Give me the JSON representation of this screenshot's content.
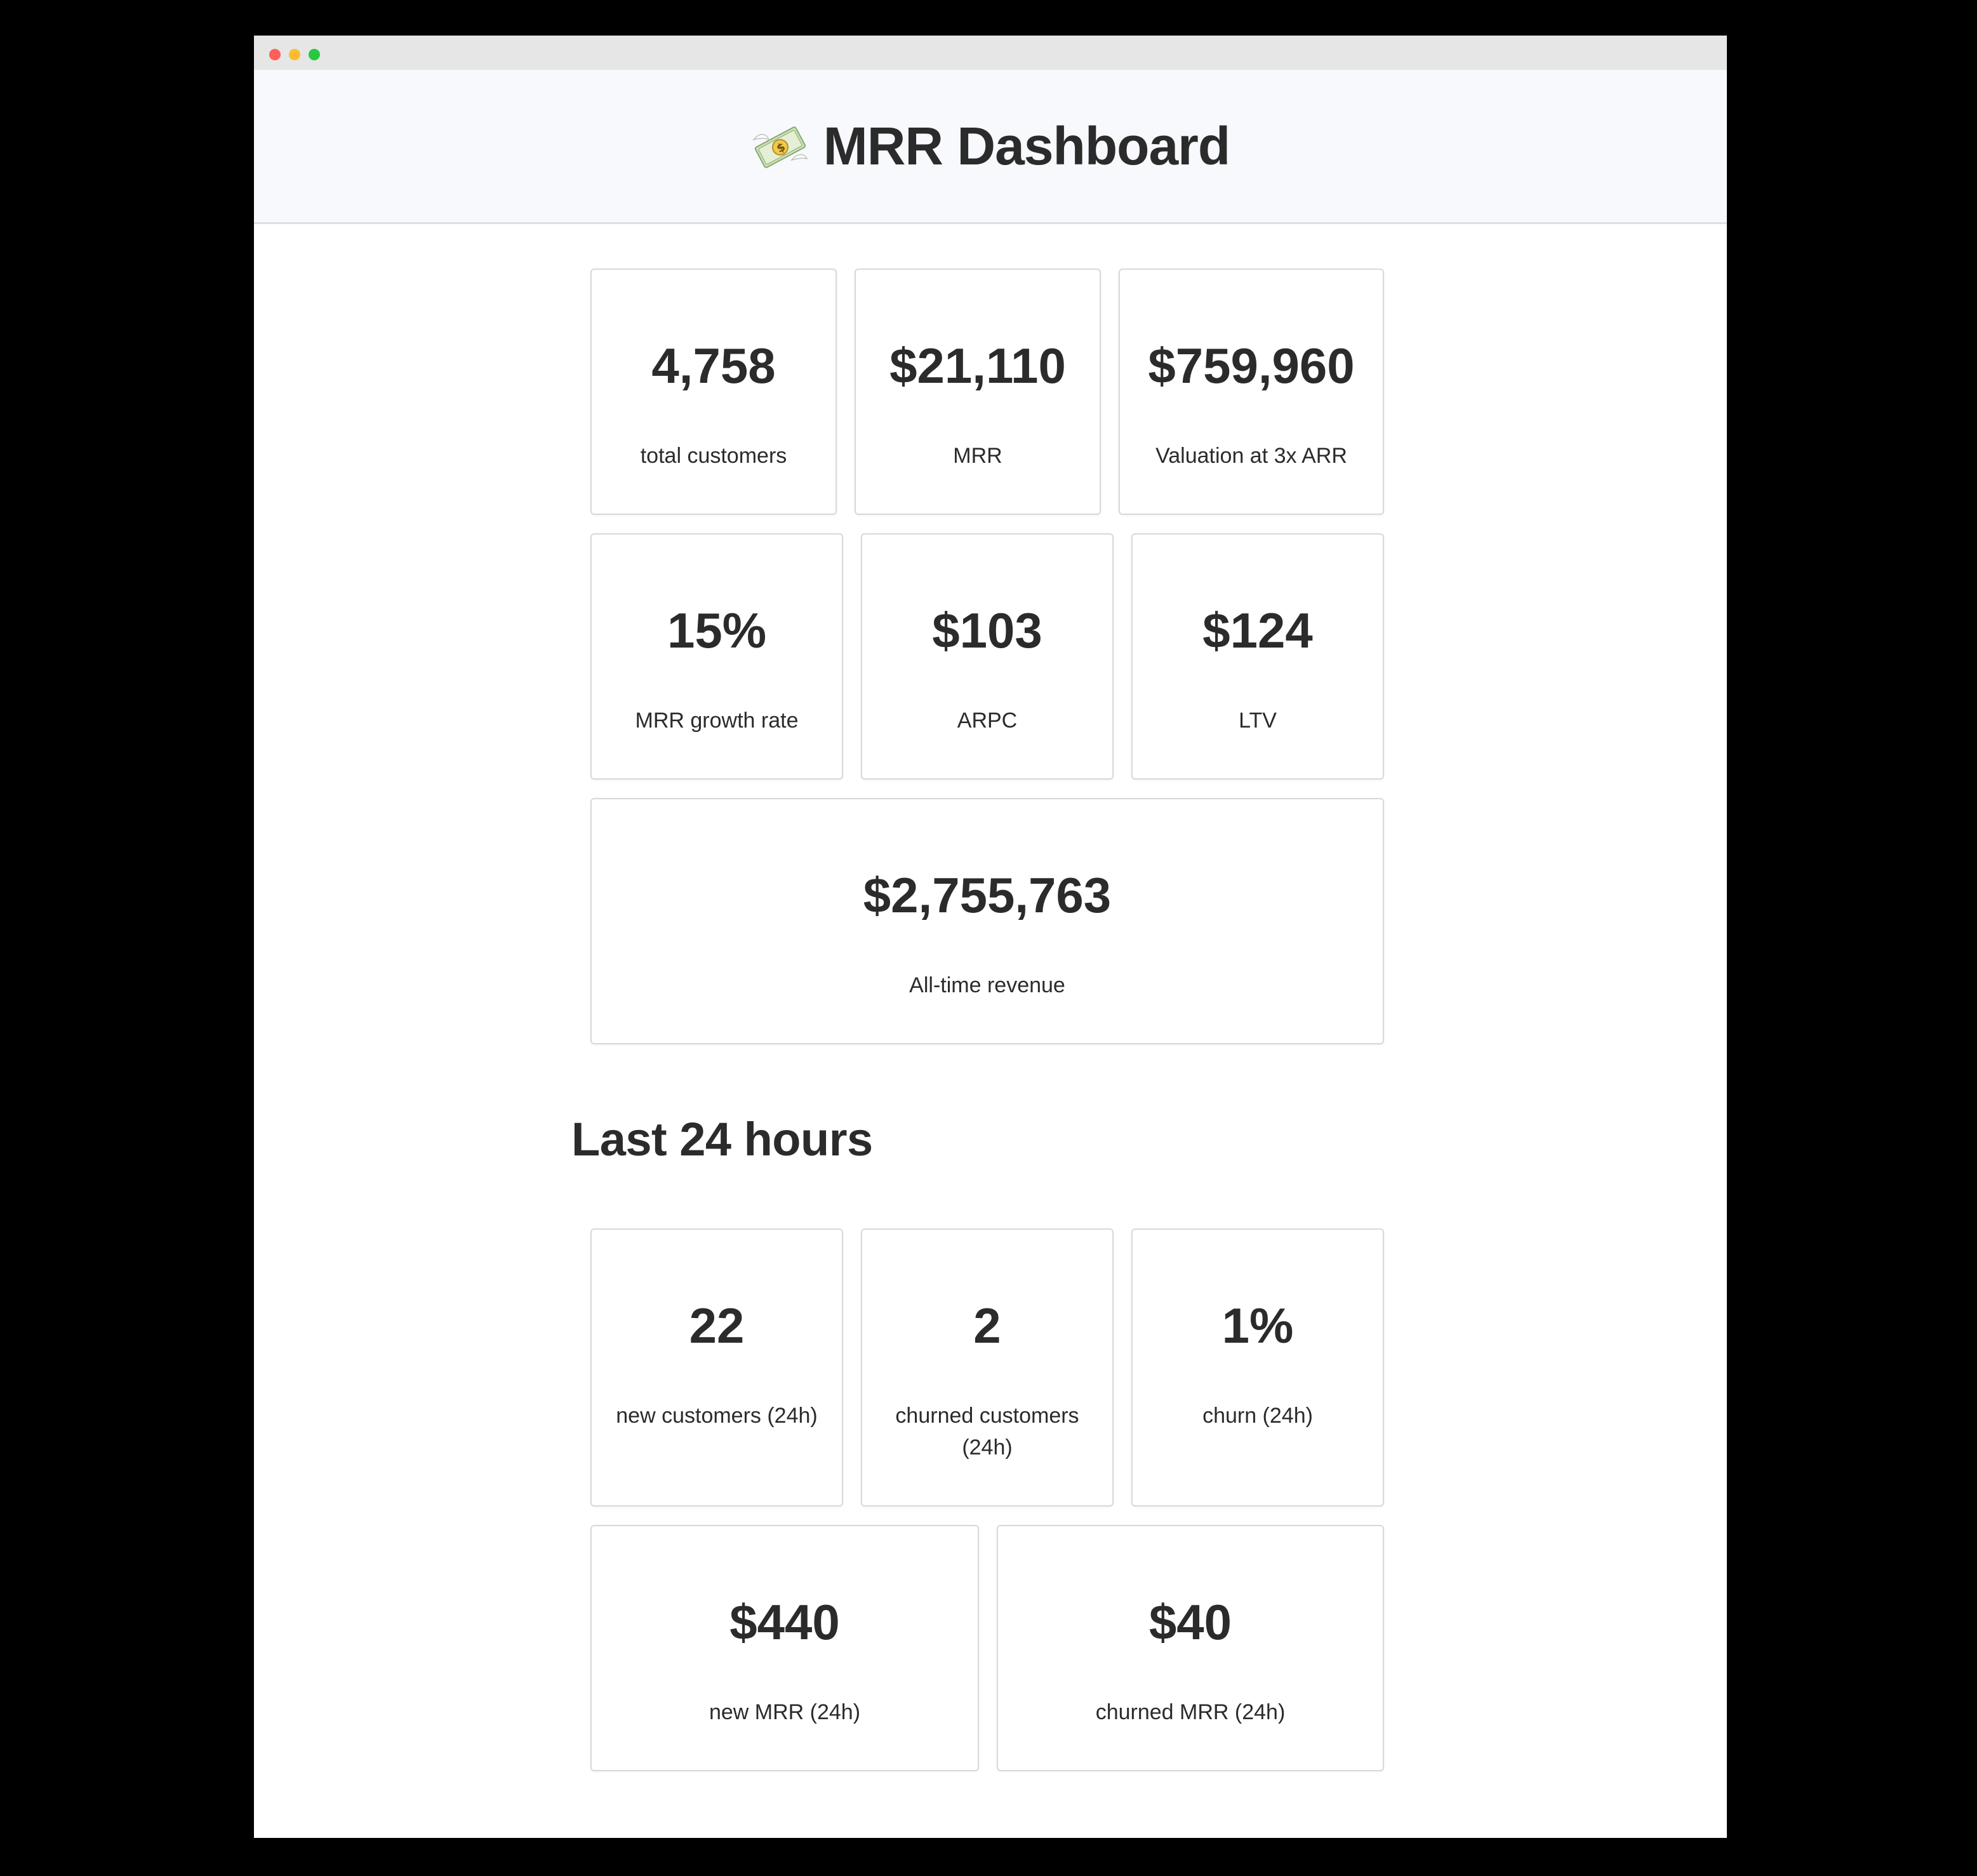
{
  "header": {
    "title": "MRR Dashboard",
    "icon": "money-with-wings-icon"
  },
  "metrics": [
    {
      "value": "4,758",
      "label": "total customers"
    },
    {
      "value": "$21,110",
      "label": "MRR"
    },
    {
      "value": "$759,960",
      "label": "Valuation at 3x ARR"
    },
    {
      "value": "15%",
      "label": "MRR growth rate"
    },
    {
      "value": "$103",
      "label": "ARPC"
    },
    {
      "value": "$124",
      "label": "LTV"
    },
    {
      "value": "$2,755,763",
      "label": "All-time revenue"
    }
  ],
  "last24": {
    "title": "Last 24 hours",
    "metrics": [
      {
        "value": "22",
        "label": "new customers (24h)"
      },
      {
        "value": "2",
        "label": "churned customers (24h)"
      },
      {
        "value": "1%",
        "label": "churn (24h)"
      },
      {
        "value": "$440",
        "label": "new MRR (24h)"
      },
      {
        "value": "$40",
        "label": "churned MRR (24h)"
      }
    ]
  }
}
